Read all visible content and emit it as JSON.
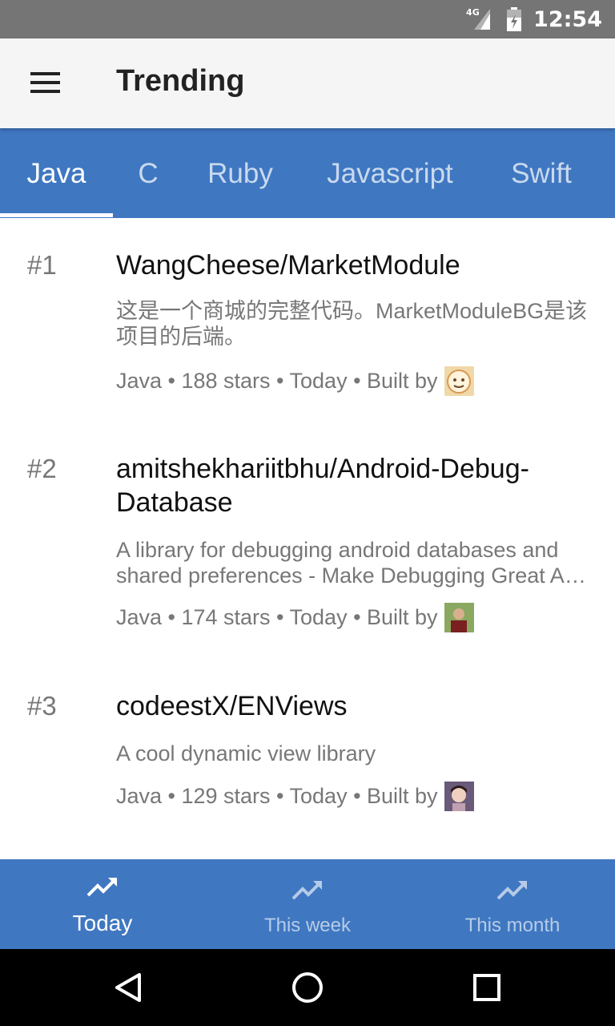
{
  "status_bar": {
    "network_label": "4G",
    "time": "12:54"
  },
  "app_bar": {
    "menu_icon": "hamburger-menu-icon",
    "title": "Trending"
  },
  "language_tabs": [
    {
      "label": "Java",
      "active": true
    },
    {
      "label": "C",
      "active": false
    },
    {
      "label": "Ruby",
      "active": false
    },
    {
      "label": "Javascript",
      "active": false
    },
    {
      "label": "Swift",
      "active": false
    }
  ],
  "repos": [
    {
      "rank": "#1",
      "name": "WangCheese/MarketModule",
      "description": "这是一个商城的完整代码。MarketModuleBG是该项目的后端。",
      "meta": "Java • 188 stars • Today • Built by",
      "avatar_color": "#f0d8a8"
    },
    {
      "rank": "#2",
      "name": "amitshekhariitbhu/Android-Debug-Database",
      "description": "A library for debugging android databases and shared preferences - Make Debugging Great A…",
      "meta": "Java • 174 stars • Today • Built by",
      "avatar_color": "#6b8a4a"
    },
    {
      "rank": "#3",
      "name": "codeestX/ENViews",
      "description": "A cool dynamic view library",
      "meta": "Java • 129 stars • Today • Built by",
      "avatar_color": "#5a4a6a"
    }
  ],
  "bottom_nav": [
    {
      "label": "Today",
      "icon": "trending-up-icon",
      "active": true
    },
    {
      "label": "This week",
      "icon": "trending-up-icon",
      "active": false
    },
    {
      "label": "This month",
      "icon": "trending-up-icon",
      "active": false
    }
  ],
  "system_nav": {
    "back": "back-icon",
    "home": "home-icon",
    "recents": "recents-icon"
  },
  "colors": {
    "primary": "#3f77c1",
    "status_bar": "#757575",
    "app_bar": "#f5f5f5"
  }
}
